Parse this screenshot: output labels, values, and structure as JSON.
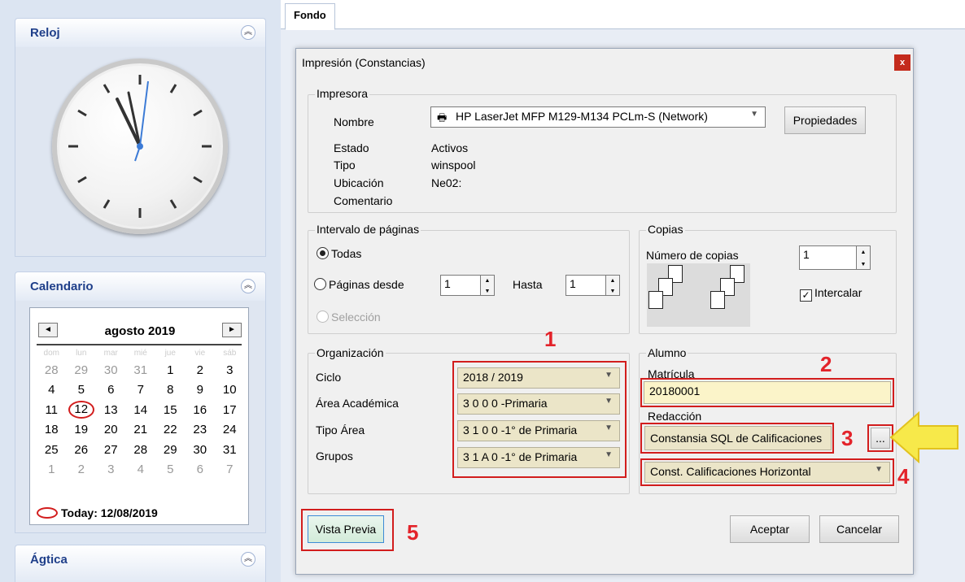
{
  "sidebar": {
    "clock_title": "Reloj",
    "calendar_title": "Calendario",
    "agtica_title": "Ágtica",
    "calendar": {
      "month": "agosto 2019",
      "prev": "◄",
      "next": "►",
      "dow": [
        "dom",
        "lun",
        "mar",
        "mié",
        "jue",
        "vie",
        "sáb"
      ],
      "weeks": [
        [
          "28",
          "29",
          "30",
          "31",
          "1",
          "2",
          "3"
        ],
        [
          "4",
          "5",
          "6",
          "7",
          "8",
          "9",
          "10"
        ],
        [
          "11",
          "12",
          "13",
          "14",
          "15",
          "16",
          "17"
        ],
        [
          "18",
          "19",
          "20",
          "21",
          "22",
          "23",
          "24"
        ],
        [
          "25",
          "26",
          "27",
          "28",
          "29",
          "30",
          "31"
        ],
        [
          "1",
          "2",
          "3",
          "4",
          "5",
          "6",
          "7"
        ]
      ],
      "today": "Today: 12/08/2019"
    }
  },
  "tabs": {
    "active": "Fondo"
  },
  "dialog": {
    "title": "Impresión (Constancias)",
    "close": "x",
    "printer": {
      "group": "Impresora",
      "name_label": "Nombre",
      "name_value": "HP LaserJet MFP M129-M134 PCLm-S (Network)",
      "properties": "Propiedades",
      "status_label": "Estado",
      "status_value": "Activos",
      "type_label": "Tipo",
      "type_value": "winspool",
      "location_label": "Ubicación",
      "location_value": "Ne02:",
      "comment_label": "Comentario"
    },
    "range": {
      "group": "Intervalo de páginas",
      "all": "Todas",
      "pages_from": "Páginas desde",
      "from_value": "1",
      "to_label": "Hasta",
      "to_value": "1",
      "selection": "Selección"
    },
    "copies": {
      "group": "Copias",
      "count_label": "Número de copias",
      "count_value": "1",
      "collate": "Intercalar"
    },
    "org": {
      "group": "Organización",
      "ciclo_label": "Ciclo",
      "ciclo_value": "2018 / 2019",
      "area_label": "Área Académica",
      "area_value": "3 0 0 0 -Primaria",
      "tipo_label": "Tipo Área",
      "tipo_value": "3 1 0 0 -1° de Primaria",
      "grupos_label": "Grupos",
      "grupos_value": "3 1 A 0 -1° de Primaria"
    },
    "student": {
      "group": "Alumno",
      "matricula_label": "Matrícula",
      "matricula_value": "20180001",
      "redaccion_label": "Redacción",
      "redaccion_value": "Constansia SQL de Calificaciones",
      "browse": "...",
      "format_value": "Const. Calificaciones Horizontal"
    },
    "preview": "Vista Previa",
    "accept": "Aceptar",
    "cancel": "Cancelar"
  },
  "annotations": {
    "n1": "1",
    "n2": "2",
    "n3": "3",
    "n4": "4",
    "n5": "5"
  },
  "colors": {
    "accent_red": "#e3232a",
    "arrow_yellow": "#f7e94a",
    "combo_bg": "#ebe5c8"
  }
}
